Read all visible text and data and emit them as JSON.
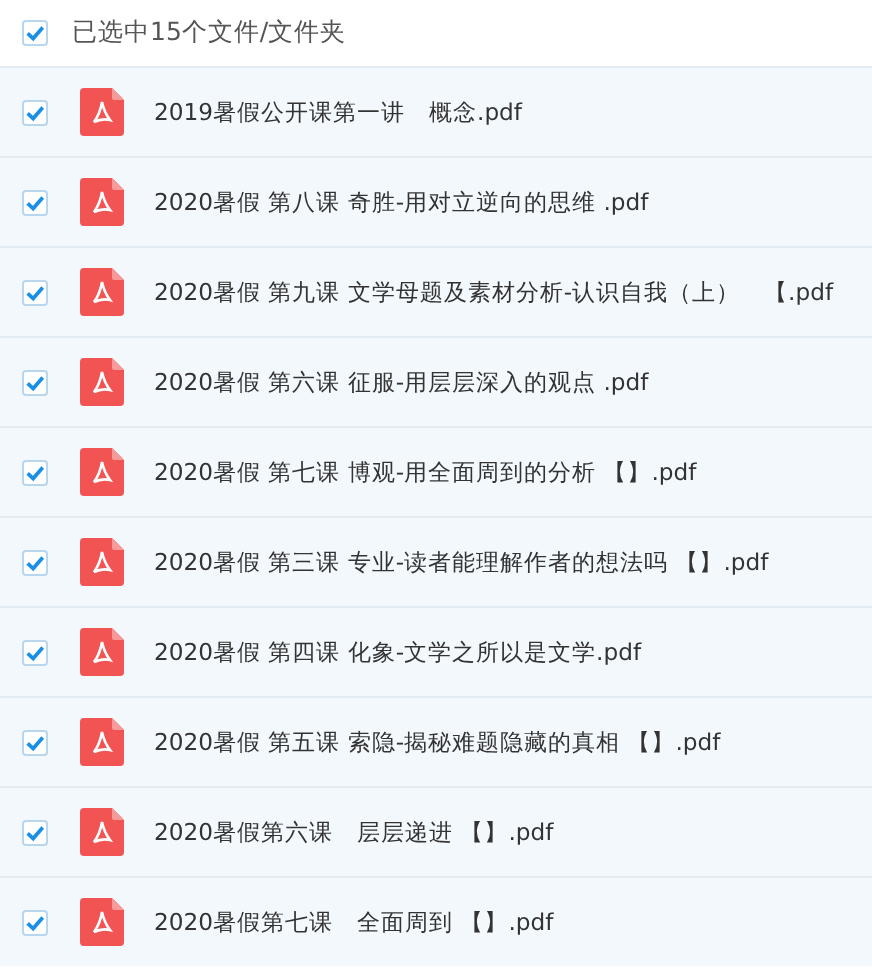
{
  "header": {
    "checked": true,
    "label": "已选中15个文件/文件夹"
  },
  "files": [
    {
      "name": "2019暑假公开课第一讲　概念.pdf",
      "checked": true
    },
    {
      "name": "2020暑假 第八课 奇胜-用对立逆向的思维 .pdf",
      "checked": true
    },
    {
      "name": "2020暑假 第九课 文学母题及素材分析-认识自我（上）　【.pdf",
      "checked": true
    },
    {
      "name": "2020暑假 第六课 征服-用层层深入的观点 .pdf",
      "checked": true
    },
    {
      "name": "2020暑假 第七课 博观-用全面周到的分析 【】.pdf",
      "checked": true
    },
    {
      "name": "2020暑假 第三课 专业-读者能理解作者的想法吗 【】.pdf",
      "checked": true
    },
    {
      "name": "2020暑假 第四课 化象-文学之所以是文学.pdf",
      "checked": true
    },
    {
      "name": "2020暑假 第五课 索隐-揭秘难题隐藏的真相 【】.pdf",
      "checked": true
    },
    {
      "name": "2020暑假第六课　层层递进 【】.pdf",
      "checked": true
    },
    {
      "name": "2020暑假第七课　全面周到 【】.pdf",
      "checked": true
    }
  ]
}
